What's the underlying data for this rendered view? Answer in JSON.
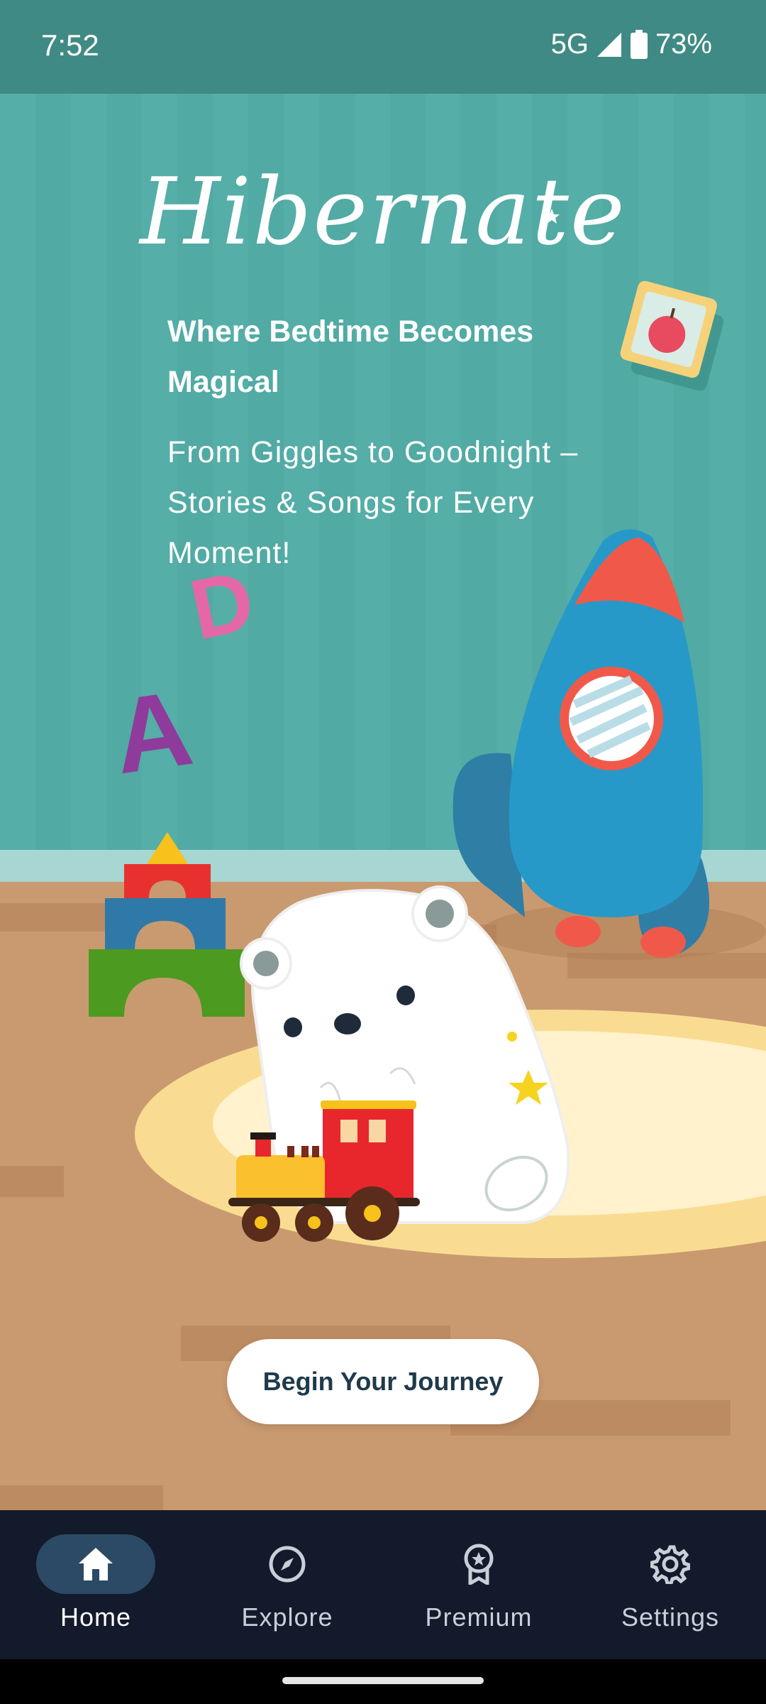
{
  "status_bar": {
    "time": "7:52",
    "network": "5G",
    "battery": "73%"
  },
  "hero": {
    "logo": "Hibernate",
    "tagline": "Where Bedtime Becomes Magical",
    "subtagline": "From Giggles to Goodnight – Stories & Songs for Every Moment!",
    "decorations": {
      "letter_pink": "D",
      "letter_purple": "A"
    }
  },
  "cta": {
    "label": "Begin Your Journey"
  },
  "bottom_nav": {
    "items": [
      {
        "label": "Home",
        "icon": "home-icon",
        "active": true
      },
      {
        "label": "Explore",
        "icon": "compass-icon",
        "active": false
      },
      {
        "label": "Premium",
        "icon": "award-icon",
        "active": false
      },
      {
        "label": "Settings",
        "icon": "gear-icon",
        "active": false
      }
    ]
  },
  "colors": {
    "wall": "#55aea7",
    "floor": "#c99a70",
    "nav_background": "#131a2b",
    "nav_active_pill": "#2c4a66",
    "cta_text": "#1f3a4a"
  }
}
